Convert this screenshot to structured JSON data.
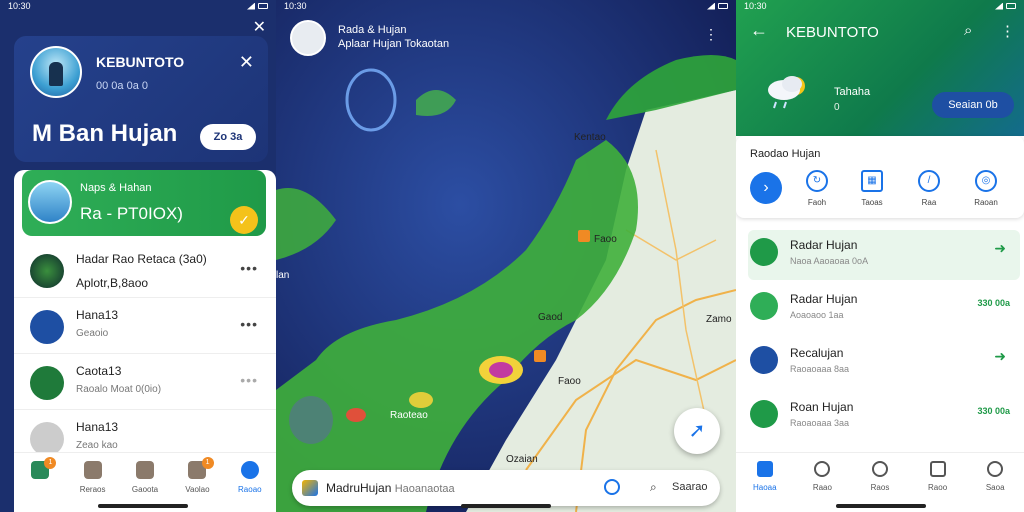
{
  "status_bar": {
    "time_left": "10:30",
    "time_mid": "10:30",
    "time_right": "10:30"
  },
  "panel_left": {
    "profile": {
      "name": "KEBUNTOTO",
      "subtitle": "00 0a 0a 0",
      "headline": "M Ban Hujan",
      "button_label": "Zo 3a"
    },
    "featured": {
      "title": "Naps & Hahan",
      "subtitle": "Ra - PT0IOX)"
    },
    "rows": [
      {
        "title": "Hadar Rao Retaca (3a0)",
        "subtitle": "Aplotr,B,8aoo"
      },
      {
        "title": "Hana13",
        "subtitle": "Geaoio"
      },
      {
        "title": "Caota13",
        "subtitle": "Raoalo Moat 0(0io)"
      },
      {
        "title": "Hana13",
        "subtitle": "Zeao kao"
      }
    ],
    "nav": [
      {
        "label": "",
        "icon": "home-icon"
      },
      {
        "label": "Reraos",
        "icon": "grid-icon"
      },
      {
        "label": "Gaoota",
        "icon": "bell-icon"
      },
      {
        "label": "Vaolao",
        "icon": "edit-icon"
      },
      {
        "label": "Raoao",
        "icon": "profile-icon"
      }
    ]
  },
  "panel_map": {
    "header": {
      "line1": "Rada & Hujan",
      "line2": "Aplaar Hujan Tokaotan"
    },
    "labels": [
      {
        "text": "Kentao"
      },
      {
        "text": "Faoo"
      },
      {
        "text": "lan"
      },
      {
        "text": "Gaod"
      },
      {
        "text": "Zamo"
      },
      {
        "text": "Raoteao"
      },
      {
        "text": "Faoo"
      },
      {
        "text": "Ozaian"
      }
    ],
    "search": {
      "app": "MadruHujan",
      "sub": "Haoanaotaa",
      "search_label": "Saarao"
    }
  },
  "panel_right": {
    "header": {
      "title": "KEBUNTOTO",
      "weather_label": "Tahaha",
      "weather_sub": "0",
      "button_label": "Seaian 0b"
    },
    "quick": {
      "title": "Raodao Hujan",
      "actions": [
        {
          "label": "Faoh"
        },
        {
          "label": "Taoas"
        },
        {
          "label": "Raa"
        },
        {
          "label": "Raoan"
        }
      ]
    },
    "list": [
      {
        "title": "Radar Hujan",
        "subtitle": "Naoa Aaoaoaa 0oA",
        "right": ""
      },
      {
        "title": "Radar Hujan",
        "subtitle": "Aoaoaoo 1aa",
        "right": "330 00a"
      },
      {
        "title": "Recalujan",
        "subtitle": "Raoaoaaa 8aa",
        "right": ""
      },
      {
        "title": "Roan Hujan",
        "subtitle": "Raoaoaaa 3aa",
        "right": "330 00a"
      }
    ],
    "nav": [
      {
        "label": "Haoaa"
      },
      {
        "label": "Raao"
      },
      {
        "label": "Raos"
      },
      {
        "label": "Raoo"
      },
      {
        "label": "Saoa"
      }
    ]
  },
  "colors": {
    "accent_blue": "#1a73e8",
    "brand_green": "#1f9a48",
    "navy": "#1b2f6d",
    "orange": "#f08a24"
  }
}
